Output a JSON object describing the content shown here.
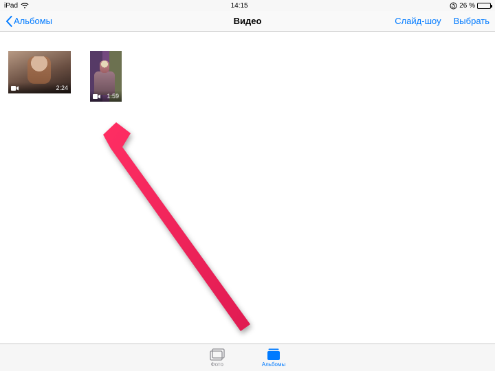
{
  "status": {
    "device": "iPad",
    "time": "14:15",
    "battery_pct": "26 %",
    "battery_fill": 26
  },
  "nav": {
    "back_label": "Альбомы",
    "title": "Видео",
    "slideshow": "Слайд-шоу",
    "select": "Выбрать"
  },
  "videos": [
    {
      "duration": "2:24"
    },
    {
      "duration": "1:59"
    }
  ],
  "tabs": {
    "photos": "Фото",
    "albums": "Альбомы"
  }
}
